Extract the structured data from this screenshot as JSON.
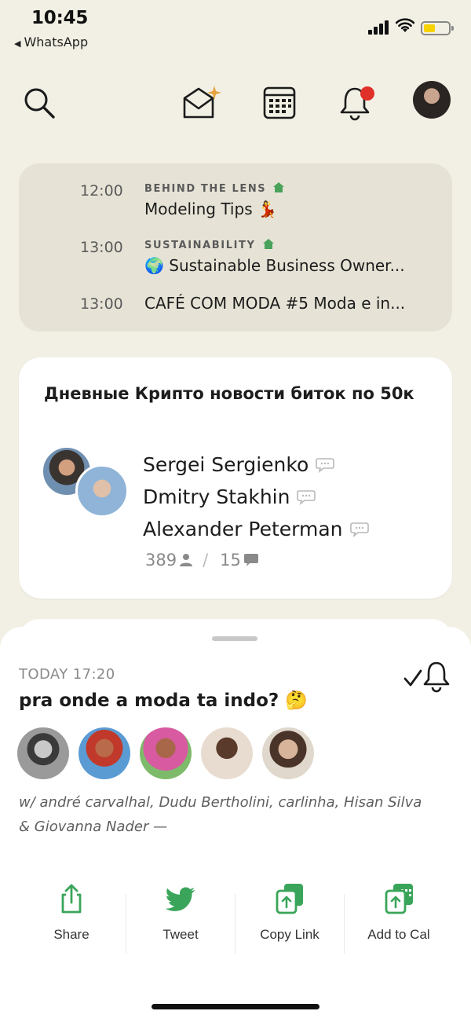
{
  "status_bar": {
    "time": "10:45",
    "back_app": "WhatsApp",
    "battery_color": "#f6d200"
  },
  "top_nav": {
    "icons": [
      "search-icon",
      "invite-envelope-icon",
      "calendar-icon",
      "notifications-bell-icon",
      "profile-avatar"
    ],
    "notification_dot_color": "#e0302a"
  },
  "schedule": {
    "events": [
      {
        "time": "12:00",
        "club": "BEHIND THE LENS",
        "title": "Modeling Tips 💃"
      },
      {
        "time": "13:00",
        "club": "SUSTAINABILITY",
        "title": "🌍 Sustainable Business Owner..."
      },
      {
        "time": "13:00",
        "club": "",
        "title": "CAFÉ COM MODA #5 Moda e in..."
      }
    ],
    "club_icon_color": "#4aa35a"
  },
  "room": {
    "title": "Дневные Крипто новости биток по 50к",
    "speakers": [
      "Sergei Sergienko",
      "Dmitry Stakhin",
      "Alexander Peterman"
    ],
    "listener_count": "389",
    "separator": "/",
    "speaker_count": "15"
  },
  "event_sheet": {
    "date": "TODAY 17:20",
    "title": "pra onde a moda ta indo? 🤔",
    "hosts_text": "w/ andré carvalhal, Dudu Bertholini, carlinha, Hisan Silva & Giovanna Nader —",
    "actions": [
      {
        "label": "Share",
        "icon": "share-icon"
      },
      {
        "label": "Tweet",
        "icon": "twitter-bird-icon"
      },
      {
        "label": "Copy Link",
        "icon": "copy-link-icon"
      },
      {
        "label": "Add to Cal",
        "icon": "add-to-calendar-icon"
      }
    ],
    "accent_color": "#3aa55a"
  }
}
